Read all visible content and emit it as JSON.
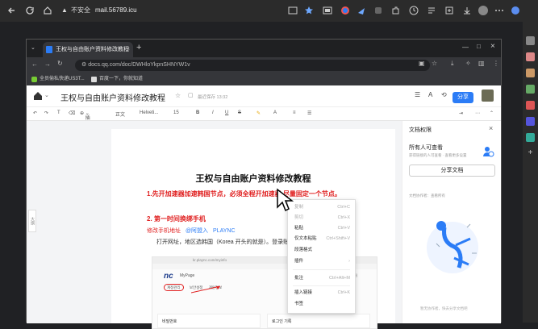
{
  "outer": {
    "security_label": "不安全",
    "url": "mail.56789.icu"
  },
  "inner": {
    "tab_title": "王权与自由账户资料修改教程",
    "url": "docs.qq.com/doc/DWHloYkpnSHNYW1v",
    "bookmarks": [
      "全员偷私快递US3T...",
      "百度一下，你就知道"
    ]
  },
  "doc": {
    "title": "王权与自由账户资料修改教程",
    "save_status": "最近保存 13:32",
    "share_label": "分享",
    "toolbar": {
      "insert": "插入",
      "style": "正文",
      "font": "Helveti...",
      "size": "15"
    },
    "side_tab": "大纲",
    "heading": "王权与自由账户资料修改教程",
    "step1": "1.先开加速器加速韩国节点，必须全程开加速器,尽量固定一个节点。",
    "step2": "2. 第一时间换绑手机",
    "link_label": "修改手机地址",
    "link_user": "@阿盟入",
    "link_site": "PLAYNC",
    "instruction": "打开网址，地区选韩国（Korea 开头的就是）。登录账",
    "embedded": {
      "url": "kr.plaync.com/myinfo",
      "brand": "nc",
      "page": "MyPage",
      "tab1": "계정관리",
      "tab2": "보안설정",
      "tab3": "개인정보",
      "field1": "비밀번호",
      "field2": "로그인 기록",
      "flags": "LOGIN 프로필"
    }
  },
  "context_menu": [
    {
      "label": "复制",
      "key": "Ctrl+C"
    },
    {
      "label": "剪切",
      "key": "Ctrl+X"
    },
    {
      "label": "粘贴",
      "key": "Ctrl+V"
    },
    {
      "label": "仅文本粘贴",
      "key": "Ctrl+Shift+V"
    },
    {
      "label": "段落格式",
      "key": ""
    },
    {
      "label": "插件",
      "key": ""
    },
    {
      "label": "批注",
      "key": "Ctrl+Alt+M"
    },
    {
      "label": "插入链接",
      "key": "Ctrl+K"
    },
    {
      "label": "书签",
      "key": ""
    }
  ],
  "panel": {
    "title": "文档权限",
    "who": "所有人可查看",
    "sub": "获得链接的人可查看 · 查看更多设置",
    "share_doc": "分享文档",
    "collab": "文档协作者：查看所有",
    "footer": "暂无协作者，快去分享文档吧"
  },
  "colors": {
    "accent": "#2b7cf6",
    "red": "#e02020"
  }
}
